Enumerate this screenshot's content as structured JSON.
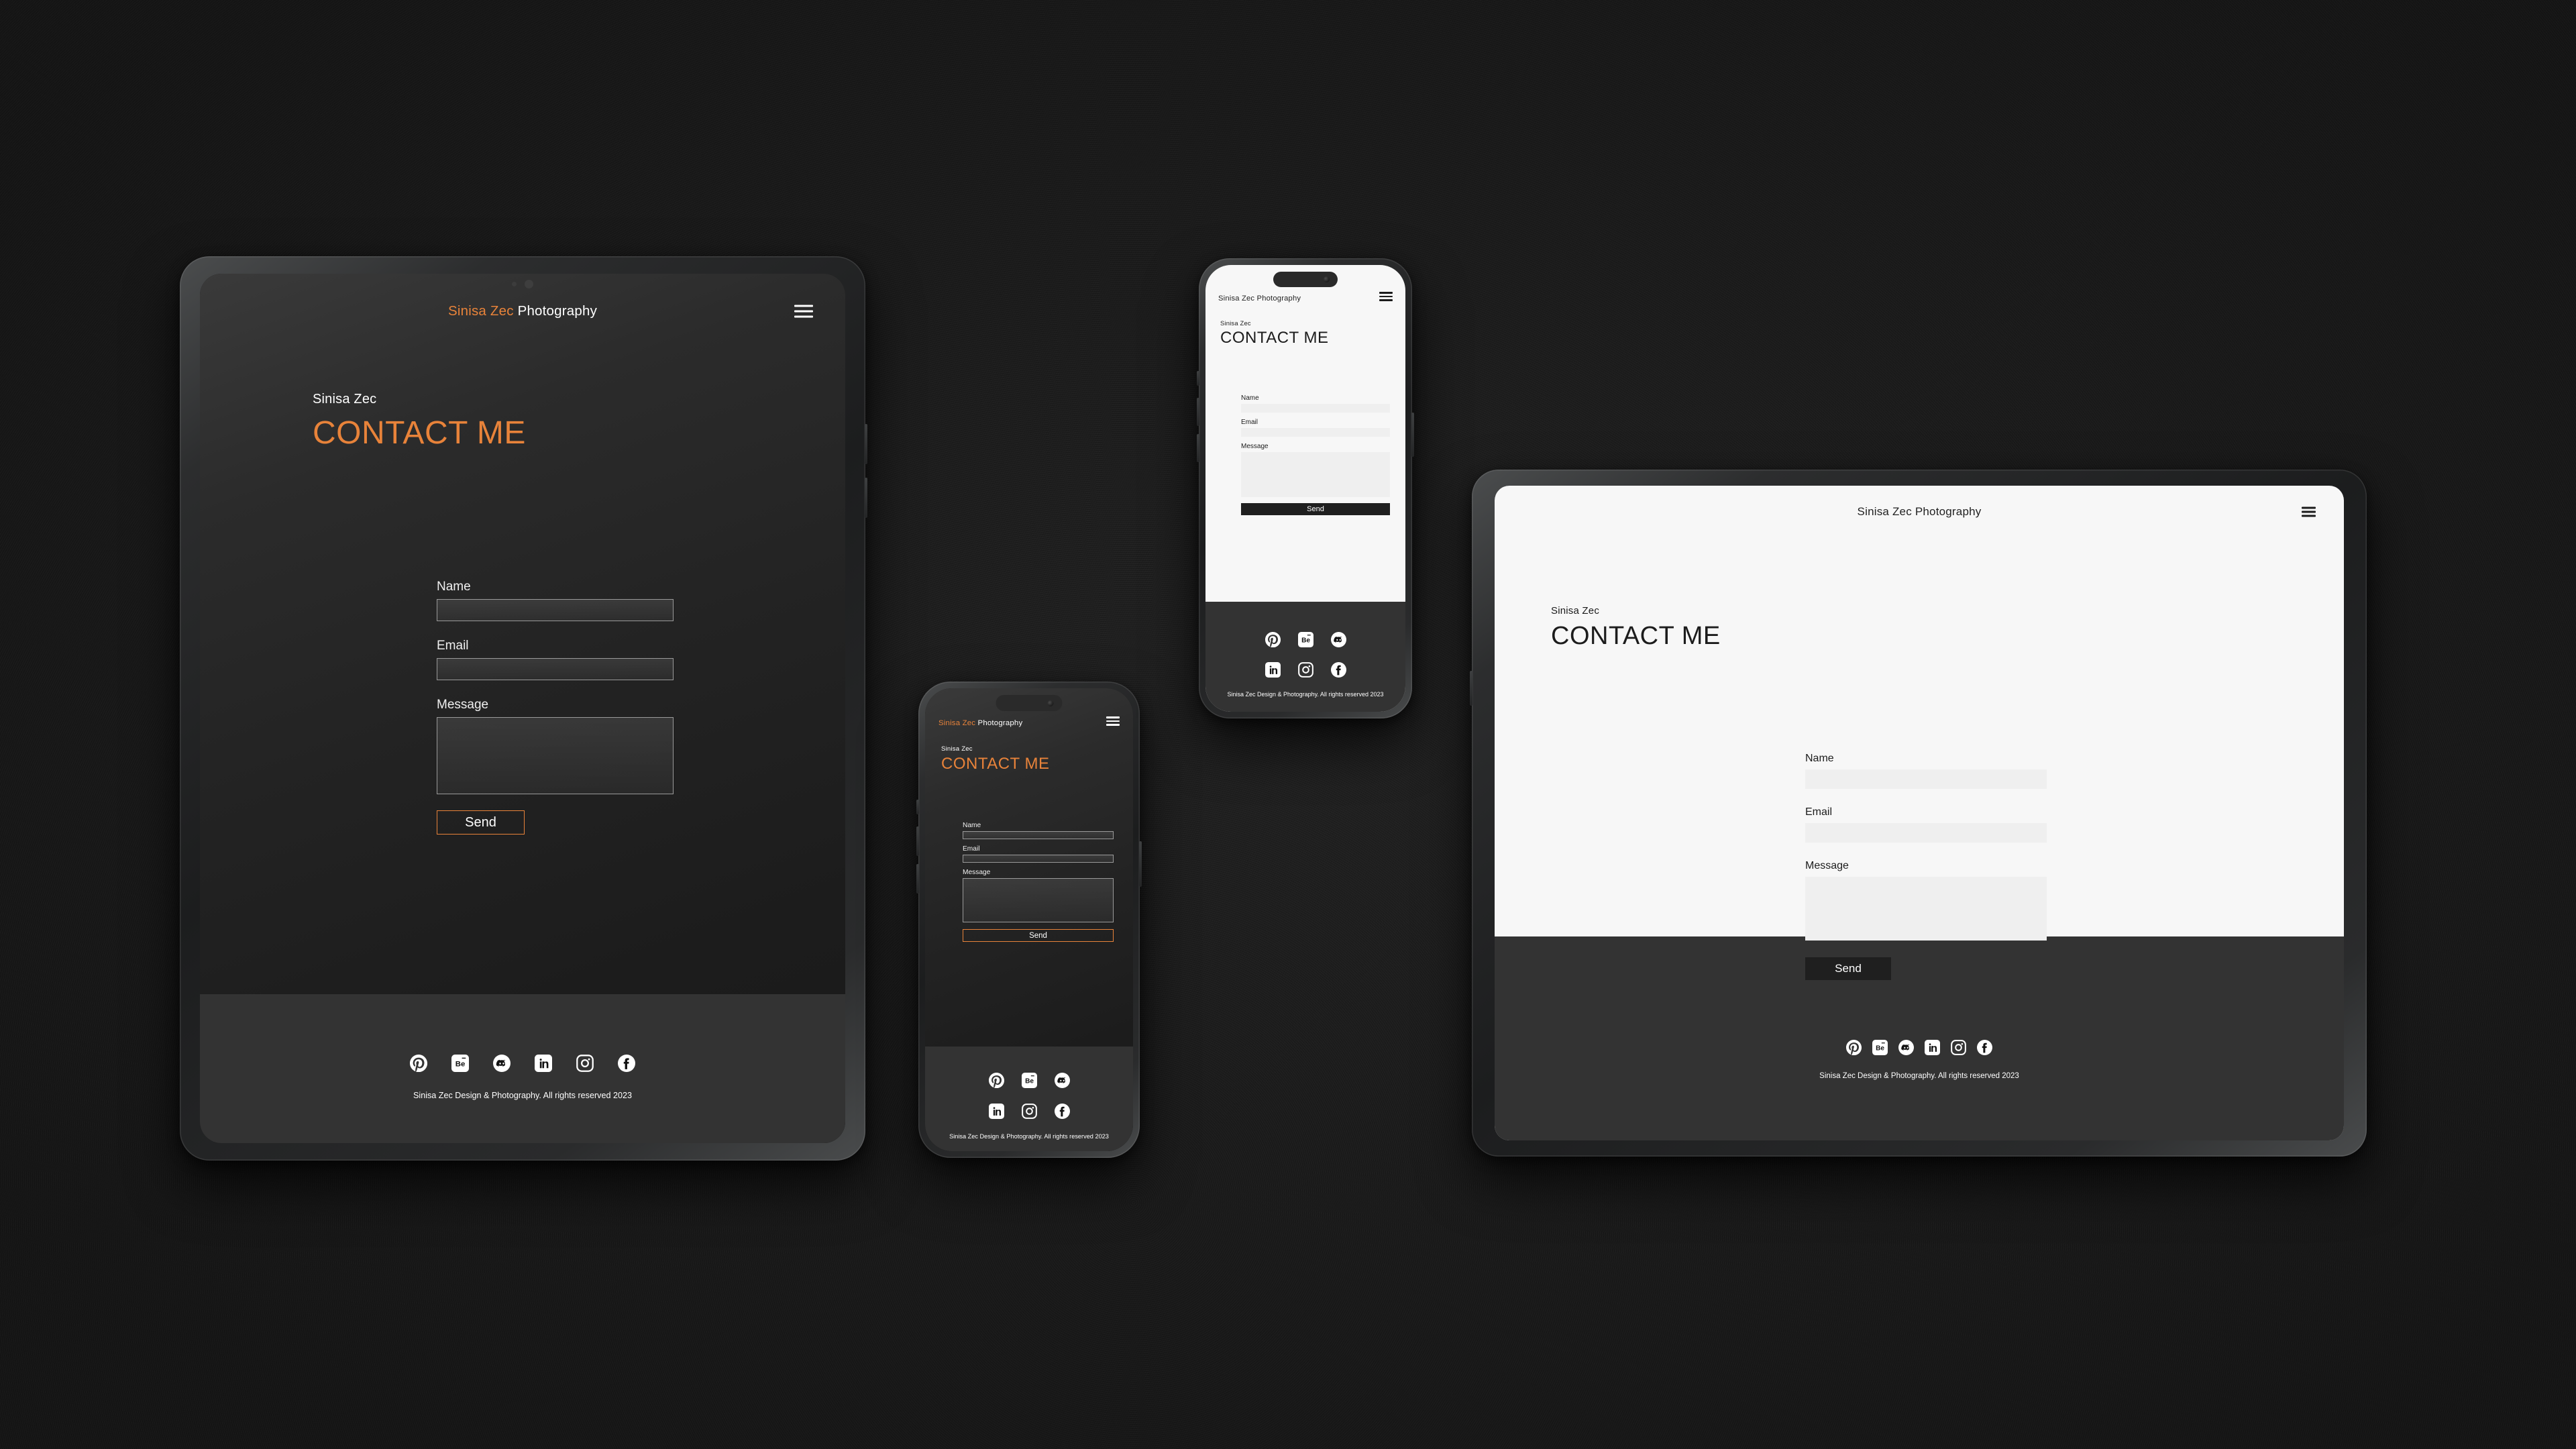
{
  "scene": {
    "background_color": "#1d1d1d",
    "accent_color": "#e8833a",
    "footer_color": "#333333",
    "light_page_color": "#f7f7f7"
  },
  "site": {
    "brand_accent": "Sinisa Zec",
    "brand_rest": " Photography",
    "eyebrow": "Sinisa Zec",
    "headline": "CONTACT ME",
    "menu_icon": "hamburger-menu-icon",
    "form": {
      "fields": [
        {
          "label": "Name",
          "value": "",
          "type": "text"
        },
        {
          "label": "Email",
          "value": "",
          "type": "text"
        },
        {
          "label": "Message",
          "value": "",
          "type": "textarea"
        }
      ],
      "submit_label": "Send"
    },
    "footer": {
      "socials": [
        {
          "name": "pinterest-icon",
          "label": "Pinterest"
        },
        {
          "name": "behance-icon",
          "label": "Behance"
        },
        {
          "name": "discord-icon",
          "label": "Discord"
        },
        {
          "name": "linkedin-icon",
          "label": "LinkedIn"
        },
        {
          "name": "instagram-icon",
          "label": "Instagram"
        },
        {
          "name": "facebook-icon",
          "label": "Facebook"
        }
      ],
      "copyright": "Sinisa Zec Design & Photography. All rights reserved 2023"
    }
  },
  "devices": [
    {
      "id": "d1",
      "name": "large-dark-tablet",
      "theme": "dark",
      "orientation": "portrait"
    },
    {
      "id": "d2",
      "name": "small-dark-phone",
      "theme": "dark",
      "orientation": "portrait"
    },
    {
      "id": "d3",
      "name": "light-phone",
      "theme": "light",
      "orientation": "portrait"
    },
    {
      "id": "d4",
      "name": "light-tablet",
      "theme": "light",
      "orientation": "landscape"
    }
  ]
}
